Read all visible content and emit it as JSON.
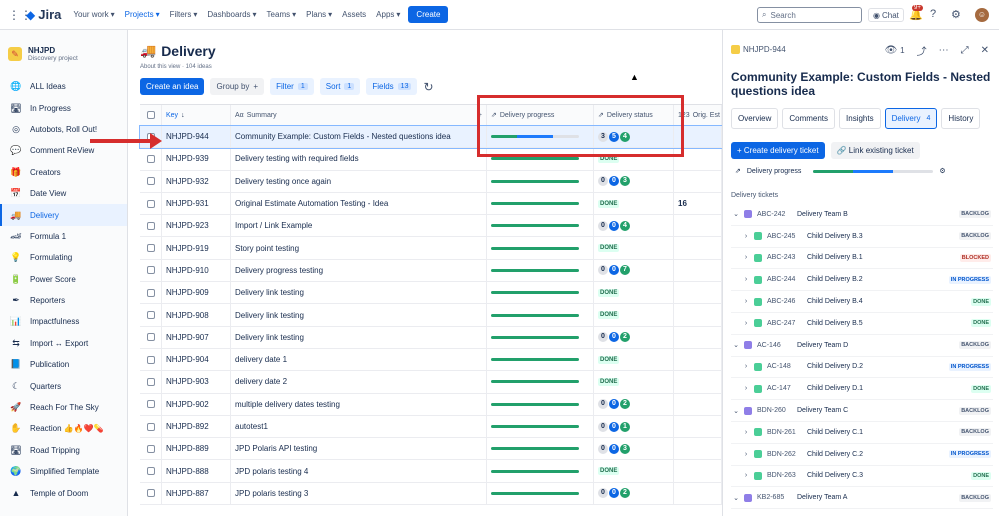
{
  "topbar": {
    "logo": "Jira",
    "nav": [
      "Your work",
      "Projects",
      "Filters",
      "Dashboards",
      "Teams",
      "Plans",
      "Assets",
      "Apps"
    ],
    "create": "Create",
    "search_placeholder": "Search",
    "chat": "Chat",
    "notif_badge": "9+"
  },
  "sidebar": {
    "project_name": "NHJPD",
    "project_type": "Discovery project",
    "items": [
      {
        "label": "ALL Ideas",
        "icon": "globe-icon"
      },
      {
        "label": "In Progress",
        "icon": "road-icon"
      },
      {
        "label": "Autobots, Roll Out!",
        "icon": "target-icon"
      },
      {
        "label": "Comment ReView",
        "icon": "speech-icon"
      },
      {
        "label": "Creators",
        "icon": "gift-icon"
      },
      {
        "label": "Date View",
        "icon": "calendar-icon"
      },
      {
        "label": "Delivery",
        "icon": "truck-icon"
      },
      {
        "label": "Formula 1",
        "icon": "car-icon"
      },
      {
        "label": "Formulating",
        "icon": "lightbulb-icon"
      },
      {
        "label": "Power Score",
        "icon": "battery-icon"
      },
      {
        "label": "Reporters",
        "icon": "pen-icon"
      },
      {
        "label": "Impactfulness",
        "icon": "chart-icon"
      },
      {
        "label": "Import ↔ Export",
        "icon": "arrows-icon"
      },
      {
        "label": "Publication",
        "icon": "book-icon"
      },
      {
        "label": "Quarters",
        "icon": "moon-icon"
      },
      {
        "label": "Reach For The Sky",
        "icon": "rocket-icon"
      },
      {
        "label": "Reaction 👍🔥❤️💊",
        "icon": "reaction-icon"
      },
      {
        "label": "Road Tripping",
        "icon": "road-icon"
      },
      {
        "label": "Simplified Template",
        "icon": "earth-icon"
      },
      {
        "label": "Temple of Doom",
        "icon": "cone-icon"
      }
    ]
  },
  "main": {
    "title": "Delivery",
    "about": "About this view · 104 ideas",
    "create_idea": "Create an idea",
    "group_by": "Group by",
    "filter": "Filter",
    "filter_count": "1",
    "sort": "Sort",
    "sort_count": "1",
    "fields": "Fields",
    "fields_count": "13",
    "columns": {
      "key": "Key",
      "summary": "Summary",
      "progress": "Delivery progress",
      "status": "Delivery status",
      "est": "Orig. Est"
    },
    "rows": [
      {
        "key": "NHJPD-944",
        "summary": "Community Example: Custom Fields - Nested questions idea",
        "prog": [
          0.3,
          0.4
        ],
        "status": [
          "3",
          "5",
          "4"
        ],
        "est": ""
      },
      {
        "key": "NHJPD-939",
        "summary": "Delivery testing with required fields",
        "prog": [
          1,
          0
        ],
        "done": "DONE",
        "est": ""
      },
      {
        "key": "NHJPD-932",
        "summary": "Delivery testing once again",
        "prog": [
          1,
          0
        ],
        "status": [
          "0",
          "0",
          "3"
        ],
        "est": ""
      },
      {
        "key": "NHJPD-931",
        "summary": "Original Estimate Automation Testing - Idea",
        "prog": [
          1,
          0
        ],
        "done": "DONE",
        "est": "16"
      },
      {
        "key": "NHJPD-923",
        "summary": "Import / Link Example",
        "prog": [
          1,
          0
        ],
        "status": [
          "0",
          "0",
          "4"
        ],
        "est": ""
      },
      {
        "key": "NHJPD-919",
        "summary": "Story point testing",
        "prog": [
          1,
          0
        ],
        "done": "DONE",
        "est": ""
      },
      {
        "key": "NHJPD-910",
        "summary": "Delivery progress testing",
        "prog": [
          1,
          0
        ],
        "status": [
          "0",
          "0",
          "7"
        ],
        "est": ""
      },
      {
        "key": "NHJPD-909",
        "summary": "Delivery link testing",
        "prog": [
          1,
          0
        ],
        "done": "DONE",
        "est": ""
      },
      {
        "key": "NHJPD-908",
        "summary": "Delivery link testing",
        "prog": [
          1,
          0
        ],
        "done": "DONE",
        "est": ""
      },
      {
        "key": "NHJPD-907",
        "summary": "Delivery link testing",
        "prog": [
          1,
          0
        ],
        "status": [
          "0",
          "0",
          "2"
        ],
        "est": ""
      },
      {
        "key": "NHJPD-904",
        "summary": "delivery date 1",
        "prog": [
          1,
          0
        ],
        "done": "DONE",
        "est": ""
      },
      {
        "key": "NHJPD-903",
        "summary": "delivery date 2",
        "prog": [
          1,
          0
        ],
        "done": "DONE",
        "est": ""
      },
      {
        "key": "NHJPD-902",
        "summary": "multiple delivery dates testing",
        "prog": [
          1,
          0
        ],
        "status": [
          "0",
          "0",
          "2"
        ],
        "est": ""
      },
      {
        "key": "NHJPD-892",
        "summary": "autotest1",
        "prog": [
          1,
          0
        ],
        "status": [
          "0",
          "0",
          "1"
        ],
        "est": ""
      },
      {
        "key": "NHJPD-889",
        "summary": "JPD Polaris API testing",
        "prog": [
          1,
          0
        ],
        "status": [
          "0",
          "0",
          "3"
        ],
        "est": ""
      },
      {
        "key": "NHJPD-888",
        "summary": "JPD polaris testing 4",
        "prog": [
          1,
          0
        ],
        "done": "DONE",
        "est": ""
      },
      {
        "key": "NHJPD-887",
        "summary": "JPD polaris testing 3",
        "prog": [
          1,
          0
        ],
        "status": [
          "0",
          "0",
          "2"
        ],
        "est": ""
      }
    ]
  },
  "panel": {
    "key": "NHJPD-944",
    "watchers": "1",
    "title": "Community Example: Custom Fields - Nested questions idea",
    "tabs": [
      {
        "label": "Overview",
        "count": ""
      },
      {
        "label": "Comments",
        "count": ""
      },
      {
        "label": "Insights",
        "count": ""
      },
      {
        "label": "Delivery",
        "count": "4"
      },
      {
        "label": "History",
        "count": ""
      }
    ],
    "create_ticket": "+ Create delivery ticket",
    "link_ticket": "Link existing ticket",
    "progress_label": "Delivery progress",
    "tickets_label": "Delivery tickets",
    "tickets": [
      {
        "key": "ABC-242",
        "summary": "Delivery Team B",
        "status": "BACKLOG",
        "type": "epic",
        "level": 0
      },
      {
        "key": "ABC-245",
        "summary": "Child Delivery B.3",
        "status": "BACKLOG",
        "type": "task",
        "level": 1
      },
      {
        "key": "ABC-243",
        "summary": "Child Delivery B.1",
        "status": "BLOCKED",
        "type": "task",
        "level": 1
      },
      {
        "key": "ABC-244",
        "summary": "Child Delivery B.2",
        "status": "IN PROGRESS",
        "type": "task",
        "level": 1
      },
      {
        "key": "ABC-246",
        "summary": "Child Delivery B.4",
        "status": "DONE",
        "type": "task",
        "level": 1
      },
      {
        "key": "ABC-247",
        "summary": "Child Delivery B.5",
        "status": "DONE",
        "type": "task",
        "level": 1
      },
      {
        "key": "AC-146",
        "summary": "Delivery Team D",
        "status": "BACKLOG",
        "type": "epic",
        "level": 0
      },
      {
        "key": "AC-148",
        "summary": "Child Delivery D.2",
        "status": "IN PROGRESS",
        "type": "task",
        "level": 1
      },
      {
        "key": "AC-147",
        "summary": "Child Delivery D.1",
        "status": "DONE",
        "type": "task",
        "level": 1
      },
      {
        "key": "BDN-260",
        "summary": "Delivery Team C",
        "status": "BACKLOG",
        "type": "epic",
        "level": 0
      },
      {
        "key": "BDN-261",
        "summary": "Child Delivery C.1",
        "status": "BACKLOG",
        "type": "task",
        "level": 1
      },
      {
        "key": "BDN-262",
        "summary": "Child Delivery C.2",
        "status": "IN PROGRESS",
        "type": "task",
        "level": 1
      },
      {
        "key": "BDN-263",
        "summary": "Child Delivery C.3",
        "status": "DONE",
        "type": "task",
        "level": 1
      },
      {
        "key": "KB2-685",
        "summary": "Delivery Team A",
        "status": "BACKLOG",
        "type": "epic",
        "level": 0
      }
    ]
  }
}
